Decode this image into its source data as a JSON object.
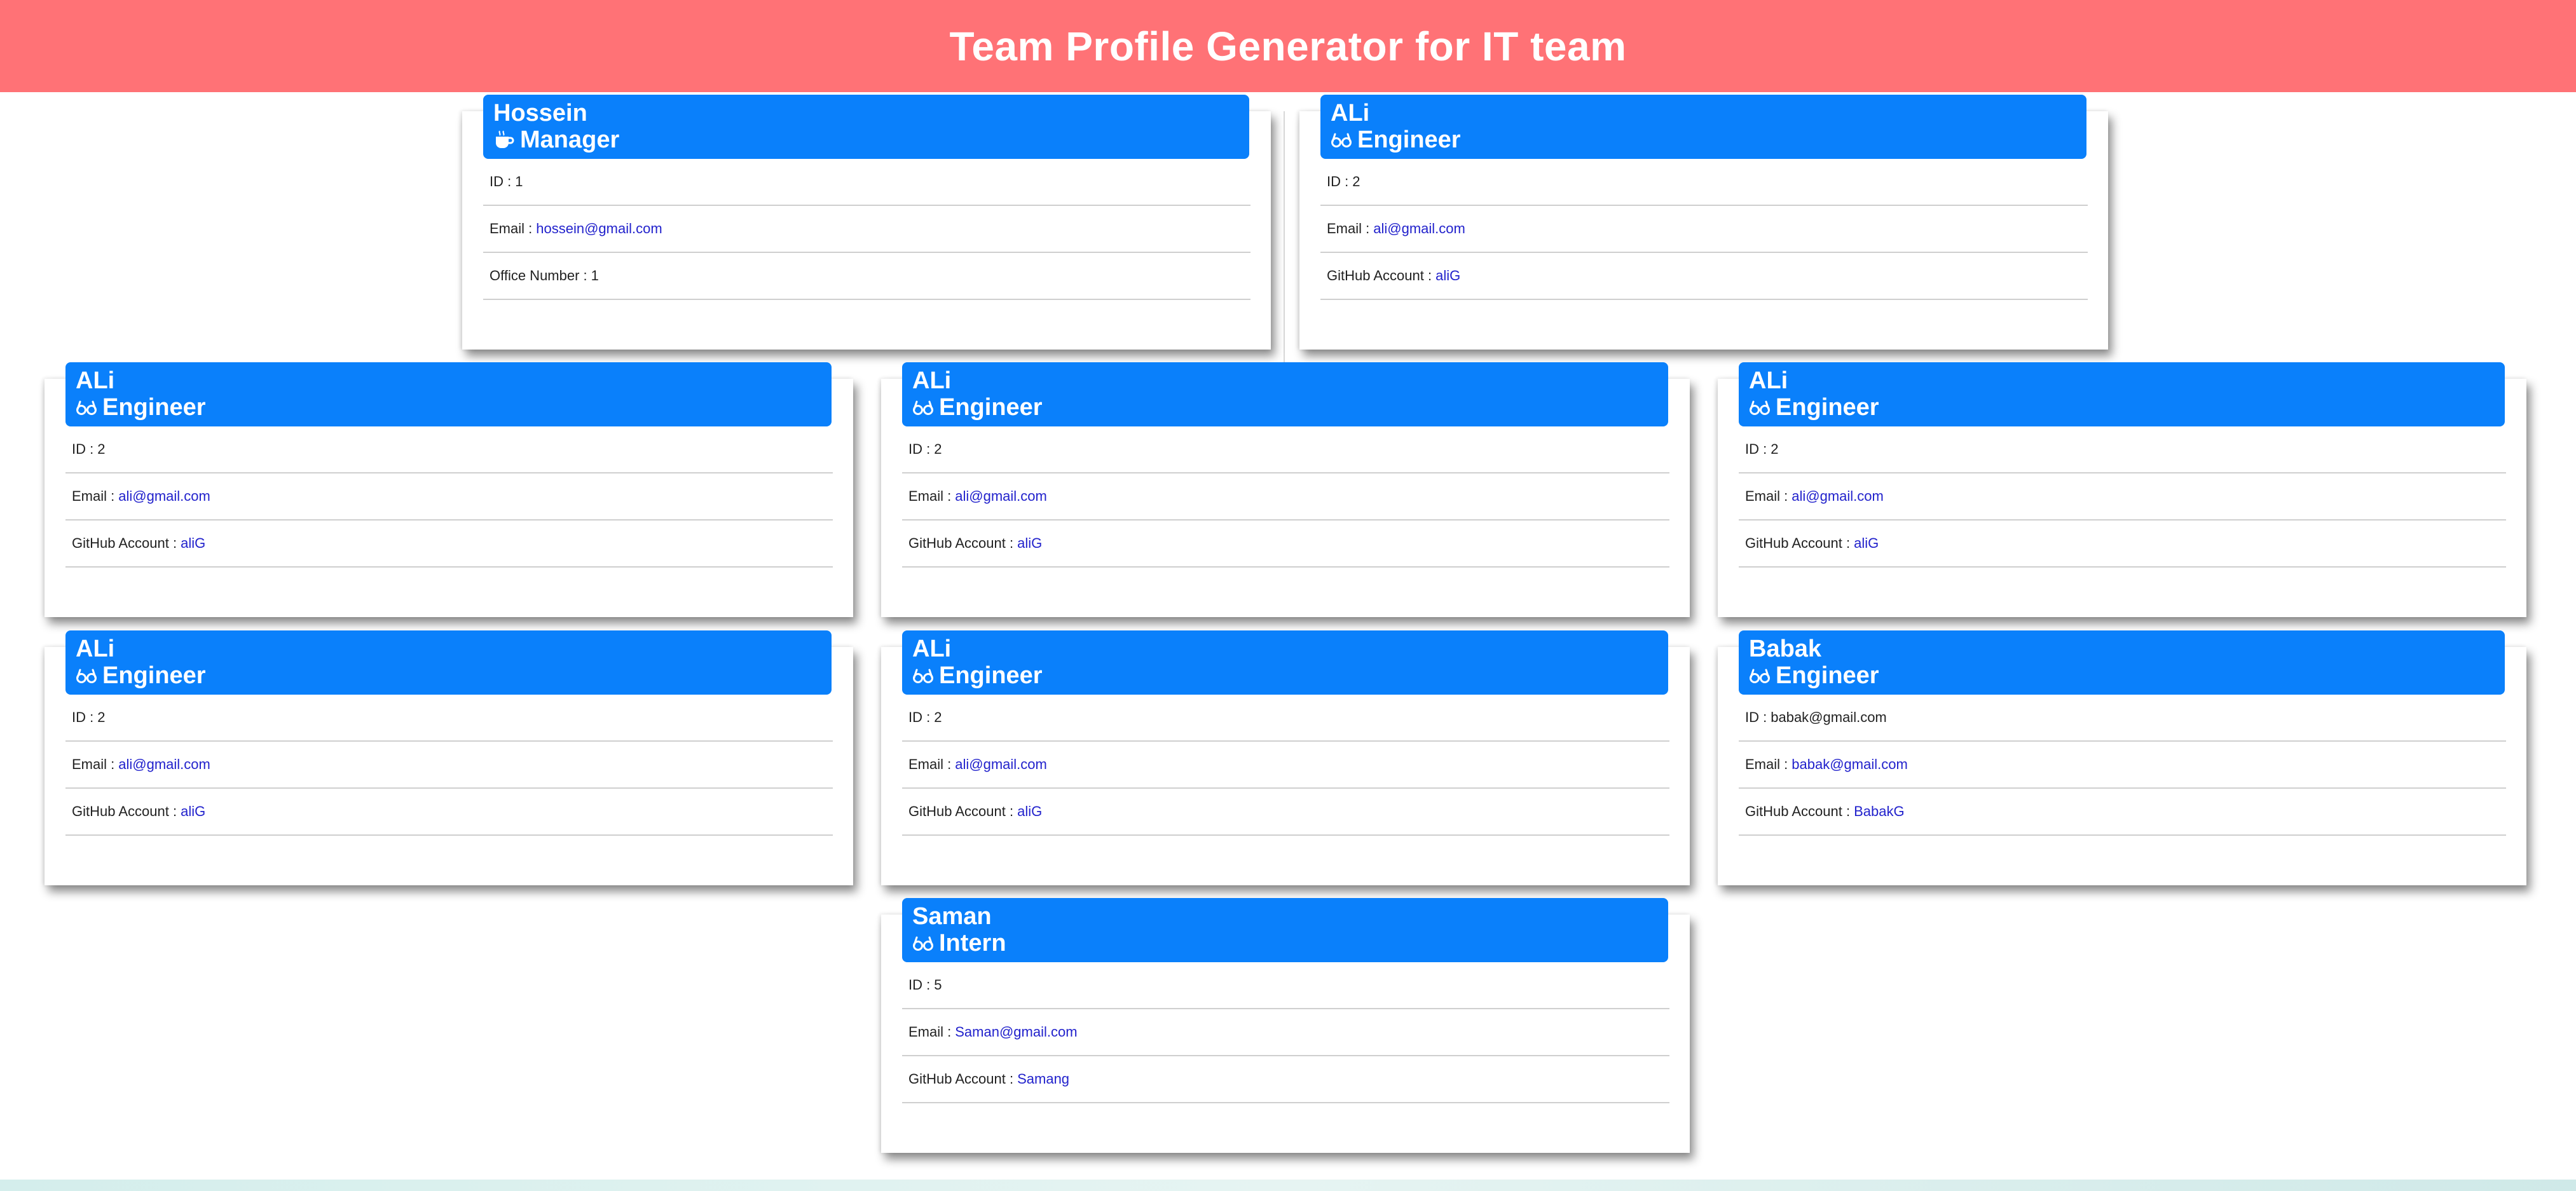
{
  "header": {
    "title": "Team Profile Generator for IT team"
  },
  "colors": {
    "header_bg": "#ff7276",
    "card_head_bg": "#0a80fb",
    "link": "#2222cc"
  },
  "cards": [
    {
      "name": "Hossein",
      "role": "Manager",
      "role_icon": "coffee-icon",
      "id_label": "ID :",
      "id": "1",
      "email_label": "Email :",
      "email": "hossein@gmail.com",
      "extra_label": "Office Number :",
      "extra": "1"
    },
    {
      "name": "ALi",
      "role": "Engineer",
      "role_icon": "glasses-icon",
      "id_label": "ID :",
      "id": "2",
      "email_label": "Email :",
      "email": "ali@gmail.com",
      "extra_label": "GitHub Account :",
      "extra": "aliG"
    },
    {
      "name": "ALi",
      "role": "Engineer",
      "role_icon": "glasses-icon",
      "id_label": "ID :",
      "id": "2",
      "email_label": "Email :",
      "email": "ali@gmail.com",
      "extra_label": "GitHub Account :",
      "extra": "aliG"
    },
    {
      "name": "ALi",
      "role": "Engineer",
      "role_icon": "glasses-icon",
      "id_label": "ID :",
      "id": "2",
      "email_label": "Email :",
      "email": "ali@gmail.com",
      "extra_label": "GitHub Account :",
      "extra": "aliG"
    },
    {
      "name": "ALi",
      "role": "Engineer",
      "role_icon": "glasses-icon",
      "id_label": "ID :",
      "id": "2",
      "email_label": "Email :",
      "email": "ali@gmail.com",
      "extra_label": "GitHub Account :",
      "extra": "aliG"
    },
    {
      "name": "ALi",
      "role": "Engineer",
      "role_icon": "glasses-icon",
      "id_label": "ID :",
      "id": "2",
      "email_label": "Email :",
      "email": "ali@gmail.com",
      "extra_label": "GitHub Account :",
      "extra": "aliG"
    },
    {
      "name": "ALi",
      "role": "Engineer",
      "role_icon": "glasses-icon",
      "id_label": "ID :",
      "id": "2",
      "email_label": "Email :",
      "email": "ali@gmail.com",
      "extra_label": "GitHub Account :",
      "extra": "aliG"
    },
    {
      "name": "Babak",
      "role": "Engineer",
      "role_icon": "glasses-icon",
      "id_label": "ID :",
      "id": "babak@gmail.com",
      "email_label": "Email :",
      "email": "babak@gmail.com",
      "extra_label": "GitHub Account :",
      "extra": "BabakG"
    },
    {
      "name": "Saman",
      "role": "Intern",
      "role_icon": "glasses-icon",
      "id_label": "ID :",
      "id": "5",
      "email_label": "Email :",
      "email": "Saman@gmail.com",
      "extra_label": "GitHub Account :",
      "extra": "Samang"
    }
  ]
}
